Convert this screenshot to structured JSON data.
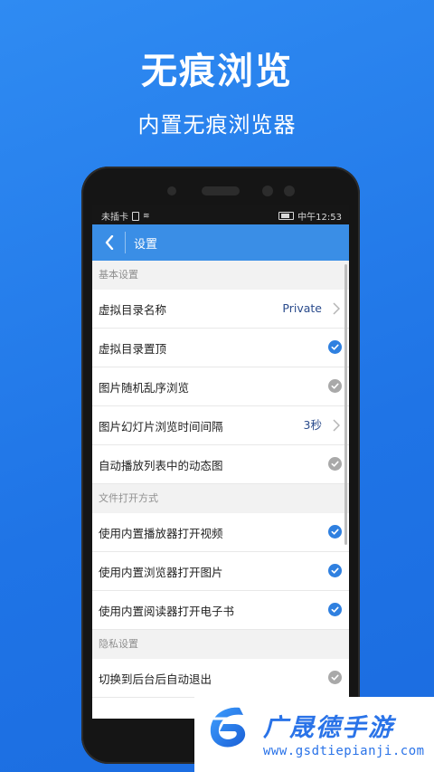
{
  "promo": {
    "headline": "无痕浏览",
    "subline": "内置无痕浏览器"
  },
  "status_bar": {
    "carrier": "未插卡",
    "time": "中午12:53",
    "icons": [
      "sim-icon",
      "wifi-icon",
      "battery-icon"
    ]
  },
  "app_bar": {
    "title": "设置",
    "back_icon": "chevron-left-icon"
  },
  "sections": {
    "basic": {
      "header": "基本设置",
      "rows": [
        {
          "label": "虚拟目录名称",
          "value": "Private",
          "control": "chevron"
        },
        {
          "label": "虚拟目录置顶",
          "control": "check",
          "checked": true
        },
        {
          "label": "图片随机乱序浏览",
          "control": "check",
          "checked": false
        },
        {
          "label": "图片幻灯片浏览时间间隔",
          "value": "3秒",
          "control": "chevron"
        },
        {
          "label": "自动播放列表中的动态图",
          "control": "check",
          "checked": false
        }
      ]
    },
    "open_mode": {
      "header": "文件打开方式",
      "rows": [
        {
          "label": "使用内置播放器打开视频",
          "control": "check",
          "checked": true
        },
        {
          "label": "使用内置浏览器打开图片",
          "control": "check",
          "checked": true
        },
        {
          "label": "使用内置阅读器打开电子书",
          "control": "check",
          "checked": true
        }
      ]
    },
    "privacy": {
      "header": "隐私设置",
      "rows": [
        {
          "label": "切换到后台后自动退出",
          "control": "check",
          "checked": false
        }
      ]
    }
  },
  "watermark": {
    "name": "广晟德手游",
    "url": "www.gsdtiepianji.com"
  },
  "colors": {
    "background": "#1f74e6",
    "app_bar": "#3a8ee6",
    "check_on": "#2f80e0",
    "check_off": "#a9a9a9",
    "value_text": "#2a4b8c",
    "brand": "#2a73e8"
  }
}
